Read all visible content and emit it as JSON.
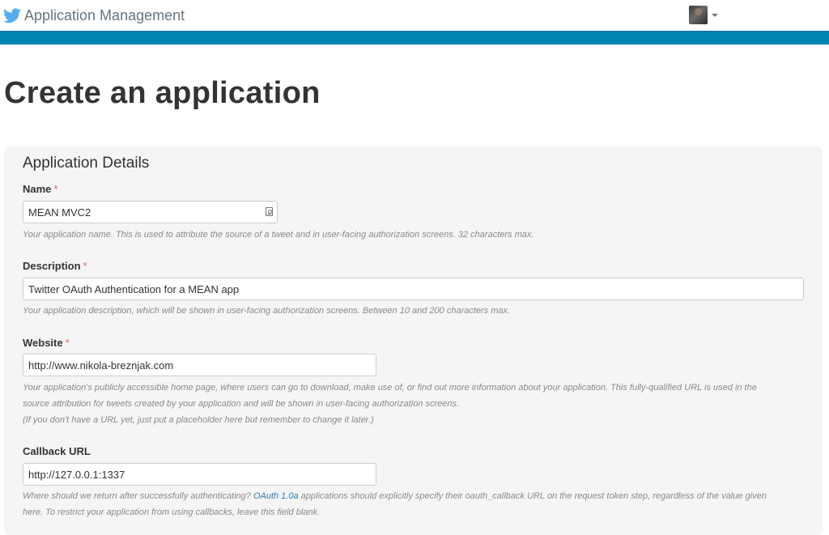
{
  "header": {
    "app_title": "Application Management",
    "logo_icon": "twitter-bird-icon",
    "menu_icon": "caret-down-icon",
    "brand_color": "#55acee",
    "bar_color": "#0084b4"
  },
  "page": {
    "title": "Create an application"
  },
  "details": {
    "title": "Application Details",
    "name": {
      "label": "Name",
      "required_mark": "*",
      "value": "MEAN MVC2",
      "help": "Your application name. This is used to attribute the source of a tweet and in user-facing authorization screens. 32 characters max."
    },
    "description": {
      "label": "Description",
      "required_mark": "*",
      "value": "Twitter OAuth Authentication for a MEAN app",
      "help": "Your application description, which will be shown in user-facing authorization screens. Between 10 and 200 characters max."
    },
    "website": {
      "label": "Website",
      "required_mark": "*",
      "value": "http://www.nikola-breznjak.com",
      "help_line1": "Your application's publicly accessible home page, where users can go to download, make use of, or find out more information about your application. This fully-qualified URL is used in the",
      "help_line2": "source attribution for tweets created by your application and will be shown in user-facing authorization screens.",
      "help_line3": "(If you don't have a URL yet, just put a placeholder here but remember to change it later.)"
    },
    "callback": {
      "label": "Callback URL",
      "value": "http://127.0.0.1:1337",
      "help_before": "Where should we return after successfully authenticating? ",
      "help_link": "OAuth 1.0a",
      "help_after": " applications should explicitly specify their oauth_callback URL on the request token step, regardless of the value given",
      "help_line2": "here. To restrict your application from using callbacks, leave this field blank."
    }
  }
}
